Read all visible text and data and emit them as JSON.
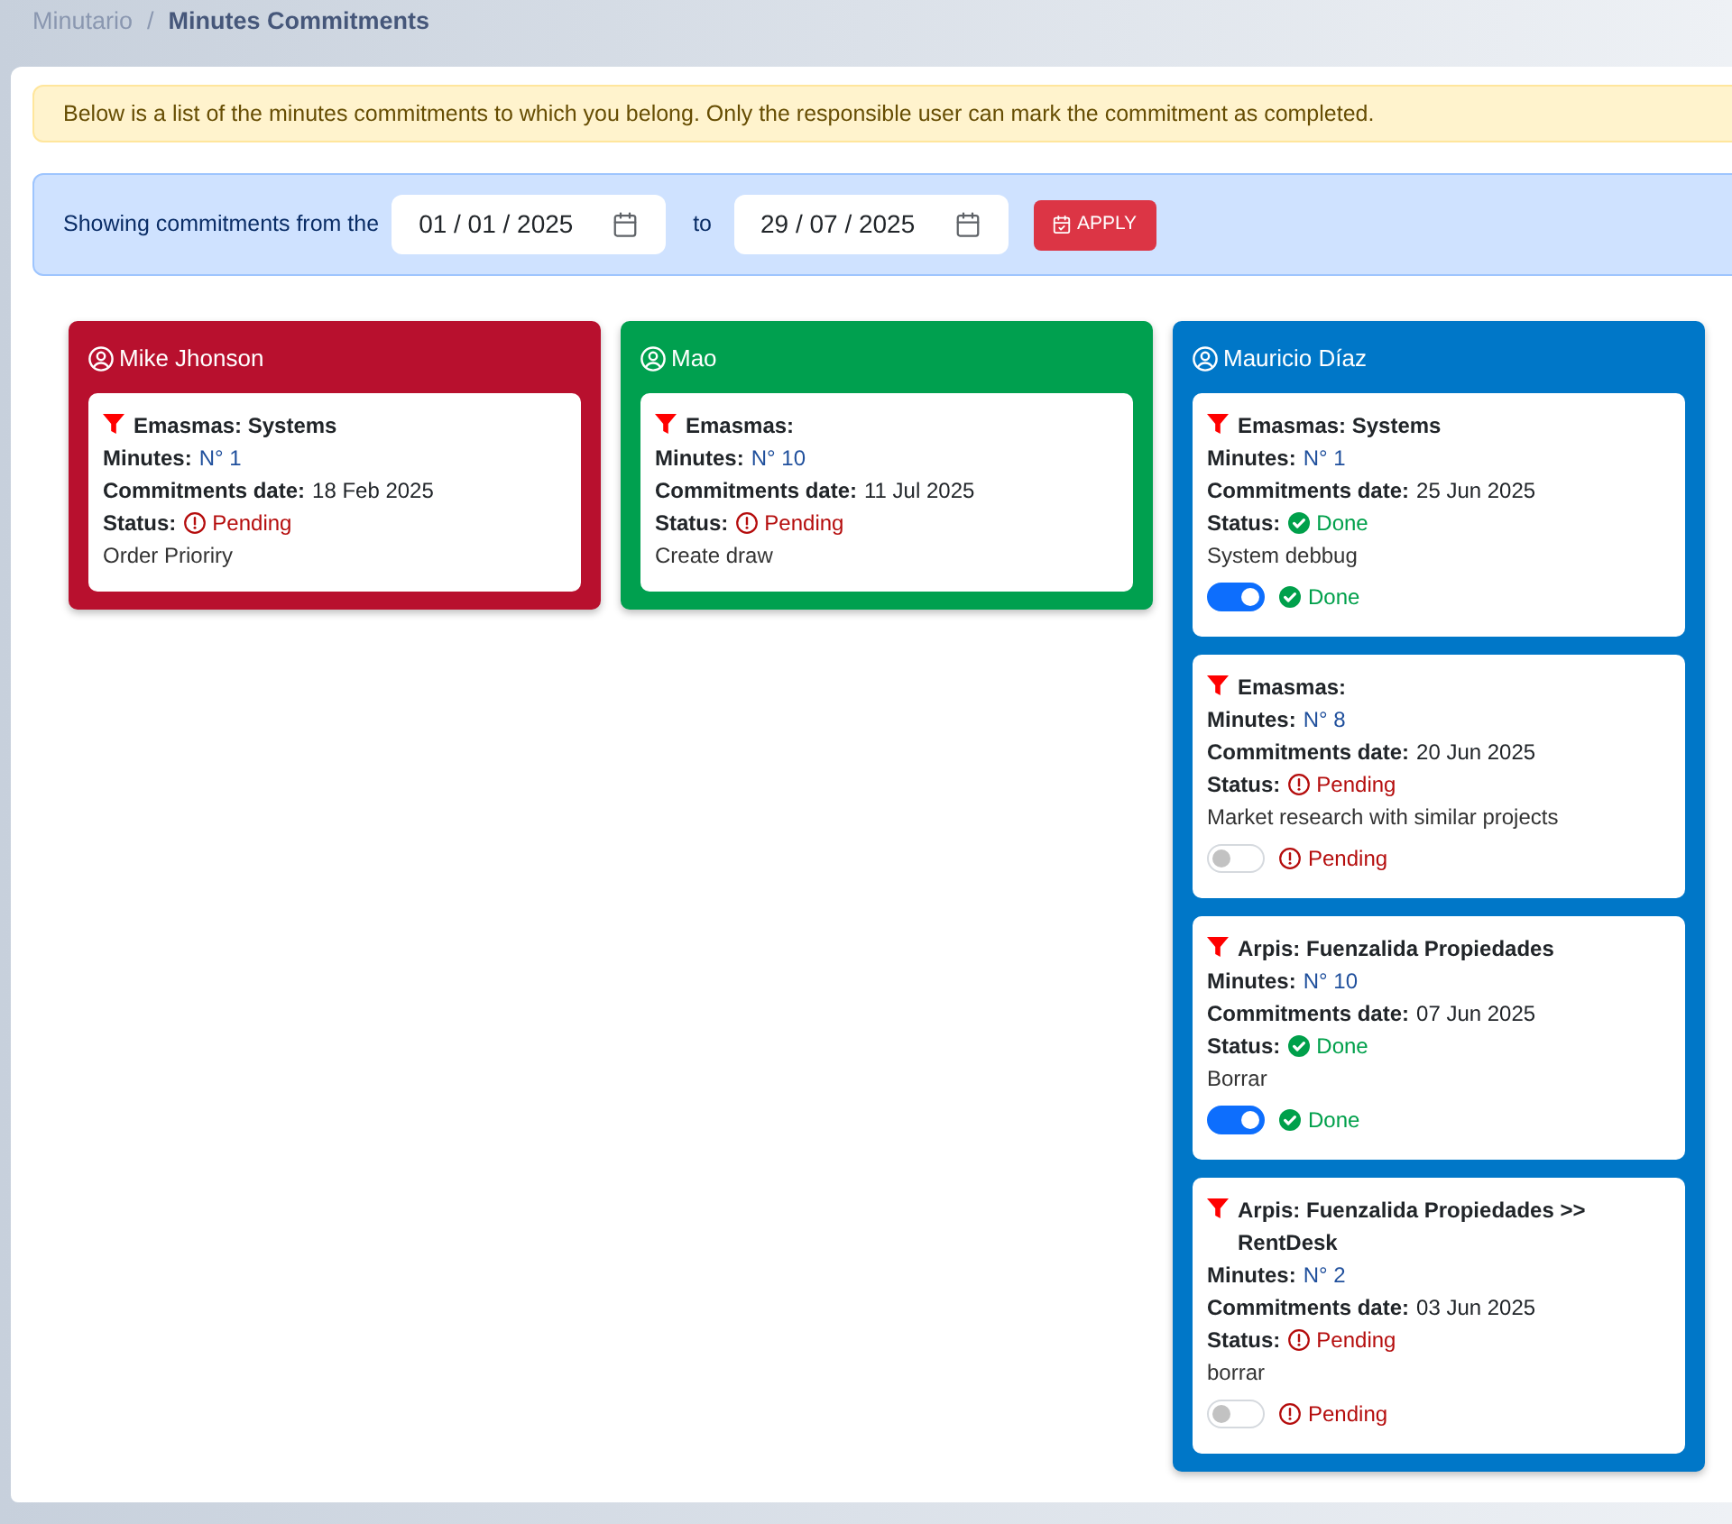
{
  "breadcrumb": {
    "separator": "/",
    "items": [
      {
        "label": "Minutario",
        "current": false
      },
      {
        "label": "Minutes Commitments",
        "current": true
      }
    ]
  },
  "alert": {
    "text": "Below is a list of the minutes commitments to which you belong. Only the responsible user can mark the commitment as completed."
  },
  "filter": {
    "label": "Showing commitments from the",
    "from_date": {
      "value": "01 / 01 / 2025"
    },
    "separator": "to",
    "to_date": {
      "value": "29 / 07 / 2025"
    },
    "apply_button": "APPLY"
  },
  "columns": [
    {
      "user": "Mike Jhonson",
      "color": "#b8102e",
      "commitments": [
        {
          "title": "Emasmas: Systems",
          "minutes_label": "Minutes:",
          "minutes": "N° 1",
          "date_label": "Commitments date:",
          "date": "18 Feb 2025",
          "status_label": "Status:",
          "status": {
            "done": false,
            "text": "Pending"
          },
          "description": "Order Prioriry"
        }
      ]
    },
    {
      "user": "Mao",
      "color": "#00a04f",
      "commitments": [
        {
          "title": "Emasmas:",
          "minutes_label": "Minutes:",
          "minutes": "N° 10",
          "date_label": "Commitments date:",
          "date": "11 Jul 2025",
          "status_label": "Status:",
          "status": {
            "done": false,
            "text": "Pending"
          },
          "description": "Create draw"
        }
      ]
    },
    {
      "user": "Mauricio Díaz",
      "color": "#0077c8",
      "commitments": [
        {
          "title": "Emasmas: Systems",
          "minutes_label": "Minutes:",
          "minutes": "N° 1",
          "date_label": "Commitments date:",
          "date": "25 Jun 2025",
          "status_label": "Status:",
          "status": {
            "done": true,
            "text": "Done"
          },
          "description": "System debbug",
          "toggle": {
            "on": true,
            "label": "Done"
          }
        },
        {
          "title": "Emasmas:",
          "minutes_label": "Minutes:",
          "minutes": "N° 8",
          "date_label": "Commitments date:",
          "date": "20 Jun 2025",
          "status_label": "Status:",
          "status": {
            "done": false,
            "text": "Pending"
          },
          "description": "Market research with similar projects",
          "toggle": {
            "on": false,
            "label": "Pending"
          }
        },
        {
          "title": "Arpis: Fuenzalida Propiedades",
          "minutes_label": "Minutes:",
          "minutes": "N° 10",
          "date_label": "Commitments date:",
          "date": "07 Jun 2025",
          "status_label": "Status:",
          "status": {
            "done": true,
            "text": "Done"
          },
          "description": "Borrar",
          "toggle": {
            "on": true,
            "label": "Done"
          }
        },
        {
          "title": "Arpis: Fuenzalida Propiedades >> RentDesk",
          "minutes_label": "Minutes:",
          "minutes": "N° 2",
          "date_label": "Commitments date:",
          "date": "03 Jun 2025",
          "status_label": "Status:",
          "status": {
            "done": false,
            "text": "Pending"
          },
          "description": "borrar",
          "toggle": {
            "on": false,
            "label": "Pending"
          }
        }
      ]
    }
  ]
}
